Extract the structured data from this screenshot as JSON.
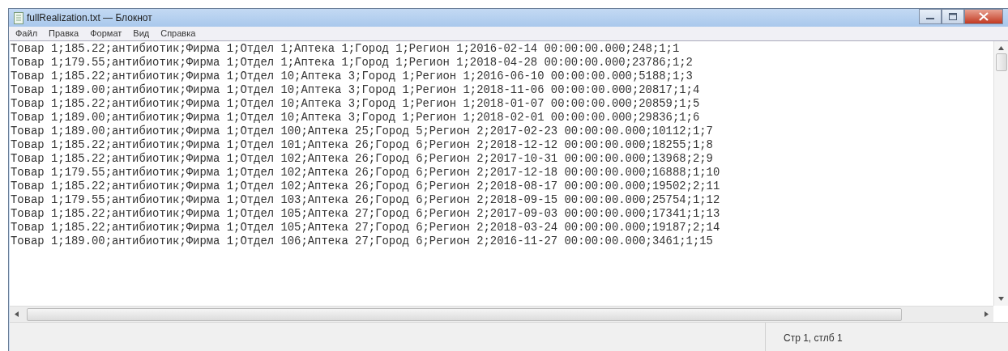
{
  "window": {
    "title": "fullRealization.txt — Блокнот"
  },
  "menu": [
    "Файл",
    "Правка",
    "Формат",
    "Вид",
    "Справка"
  ],
  "lines": [
    "Товар 1;185.22;антибиотик;Фирма 1;Отдел 1;Аптека 1;Город 1;Регион 1;2016-02-14 00:00:00.000;248;1;1",
    "Товар 1;179.55;антибиотик;Фирма 1;Отдел 1;Аптека 1;Город 1;Регион 1;2018-04-28 00:00:00.000;23786;1;2",
    "Товар 1;185.22;антибиотик;Фирма 1;Отдел 10;Аптека 3;Город 1;Регион 1;2016-06-10 00:00:00.000;5188;1;3",
    "Товар 1;189.00;антибиотик;Фирма 1;Отдел 10;Аптека 3;Город 1;Регион 1;2018-11-06 00:00:00.000;20817;1;4",
    "Товар 1;185.22;антибиотик;Фирма 1;Отдел 10;Аптека 3;Город 1;Регион 1;2018-01-07 00:00:00.000;20859;1;5",
    "Товар 1;189.00;антибиотик;Фирма 1;Отдел 10;Аптека 3;Город 1;Регион 1;2018-02-01 00:00:00.000;29836;1;6",
    "Товар 1;189.00;антибиотик;Фирма 1;Отдел 100;Аптека 25;Город 5;Регион 2;2017-02-23 00:00:00.000;10112;1;7",
    "Товар 1;185.22;антибиотик;Фирма 1;Отдел 101;Аптека 26;Город 6;Регион 2;2018-12-12 00:00:00.000;18255;1;8",
    "Товар 1;185.22;антибиотик;Фирма 1;Отдел 102;Аптека 26;Город 6;Регион 2;2017-10-31 00:00:00.000;13968;2;9",
    "Товар 1;179.55;антибиотик;Фирма 1;Отдел 102;Аптека 26;Город 6;Регион 2;2017-12-18 00:00:00.000;16888;1;10",
    "Товар 1;185.22;антибиотик;Фирма 1;Отдел 102;Аптека 26;Город 6;Регион 2;2018-08-17 00:00:00.000;19502;2;11",
    "Товар 1;179.55;антибиотик;Фирма 1;Отдел 103;Аптека 26;Город 6;Регион 2;2018-09-15 00:00:00.000;25754;1;12",
    "Товар 1;185.22;антибиотик;Фирма 1;Отдел 105;Аптека 27;Город 6;Регион 2;2017-09-03 00:00:00.000;17341;1;13",
    "Товар 1;185.22;антибиотик;Фирма 1;Отдел 105;Аптека 27;Город 6;Регион 2;2018-03-24 00:00:00.000;19187;2;14",
    "Товар 1;189.00;антибиотик;Фирма 1;Отдел 106;Аптека 27;Город 6;Регион 2;2016-11-27 00:00:00.000;3461;1;15"
  ],
  "status_bar": {
    "position": "Стр 1, стлб 1"
  }
}
